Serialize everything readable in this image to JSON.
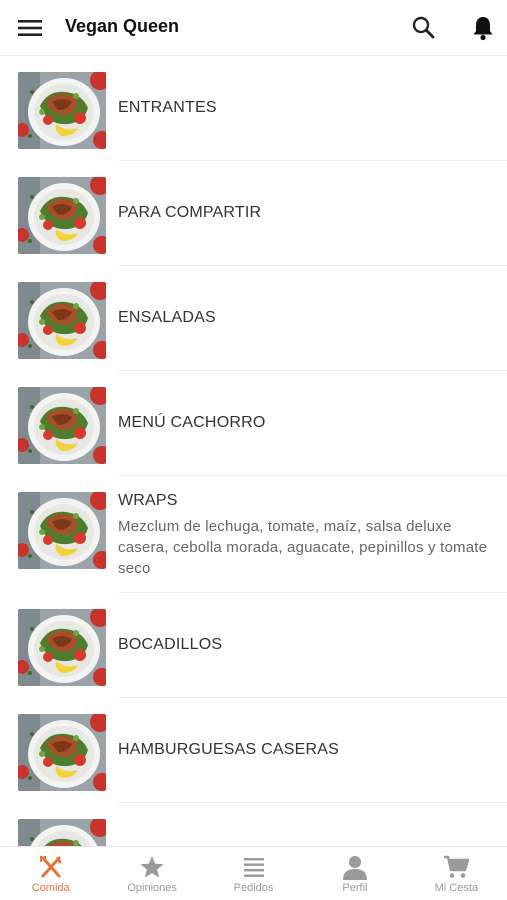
{
  "app": {
    "title": "Vegan Queen"
  },
  "header": {
    "menu_icon": "hamburger-menu-icon",
    "search_icon": "search-icon",
    "notifications_icon": "bell-icon"
  },
  "categories": [
    {
      "name": "ENTRANTES",
      "description": ""
    },
    {
      "name": "PARA COMPARTIR",
      "description": ""
    },
    {
      "name": "ENSALADAS",
      "description": ""
    },
    {
      "name": "MENÚ CACHORRO",
      "description": ""
    },
    {
      "name": "WRAPS",
      "description": "Mezclum de lechuga, tomate, maíz, salsa deluxe casera, cebolla morada, aguacate, pepinillos y tomate seco"
    },
    {
      "name": "BOCADILLOS",
      "description": ""
    },
    {
      "name": "HAMBURGUESAS CASERAS",
      "description": ""
    },
    {
      "name": "",
      "description": ""
    }
  ],
  "bottom_nav": {
    "active_color": "#e8733a",
    "inactive_color": "#9a9a9a",
    "tabs": [
      {
        "label": "Comida",
        "icon": "fork-knife-icon",
        "active": true
      },
      {
        "label": "Opiniones",
        "icon": "star-icon",
        "active": false
      },
      {
        "label": "Pedidos",
        "icon": "list-icon",
        "active": false
      },
      {
        "label": "Perfil",
        "icon": "person-icon",
        "active": false
      },
      {
        "label": "Mi Cesta",
        "icon": "cart-icon",
        "active": false
      }
    ]
  }
}
